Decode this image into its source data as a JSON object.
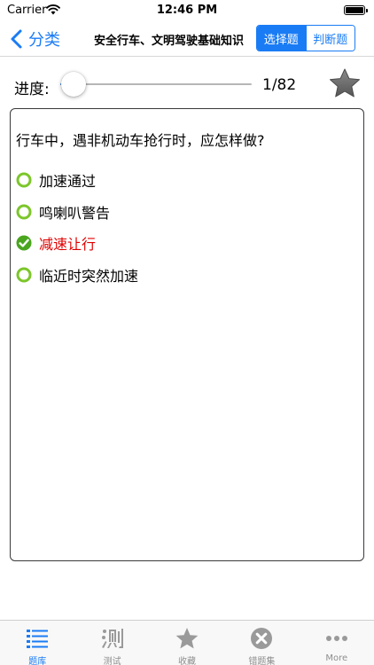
{
  "status_bar": {
    "carrier": "Carrier",
    "time": "12:46 PM",
    "battery_level": 1.0
  },
  "nav": {
    "back_label": "分类",
    "title": "安全行车、文明驾驶基础知识",
    "segments": [
      {
        "label": "选择题",
        "selected": true
      },
      {
        "label": "判断题",
        "selected": false
      }
    ]
  },
  "progress": {
    "label": "进度:",
    "count_text": "1/82",
    "current": 1,
    "total": 82,
    "slider_fraction": 0.07
  },
  "favorite": {
    "icon": "star-icon",
    "color": "#6e6e6e"
  },
  "question": {
    "text": "行车中，遇非机动车抢行时，应怎样做?",
    "options": [
      {
        "label": "加速通过",
        "correct": false,
        "icon": "radio-unselected-icon"
      },
      {
        "label": "鸣喇叭警告",
        "correct": false,
        "icon": "radio-unselected-icon"
      },
      {
        "label": "减速让行",
        "correct": true,
        "icon": "checkmark-circle-icon"
      },
      {
        "label": "临近时突然加速",
        "correct": false,
        "icon": "radio-unselected-icon"
      }
    ]
  },
  "tabs": [
    {
      "label": "题库",
      "icon": "list-icon",
      "active": true
    },
    {
      "label": "测试",
      "icon": "test-glyph-icon",
      "active": false
    },
    {
      "label": "收藏",
      "icon": "star-icon",
      "active": false
    },
    {
      "label": "错题集",
      "icon": "x-circle-icon",
      "active": false
    },
    {
      "label": "More",
      "icon": "more-icon",
      "active": false
    }
  ],
  "colors": {
    "accent": "#1a7cf5",
    "correct_text": "#e00000",
    "option_ring": "#7cc62a",
    "tab_inactive": "#8e8e8e"
  }
}
